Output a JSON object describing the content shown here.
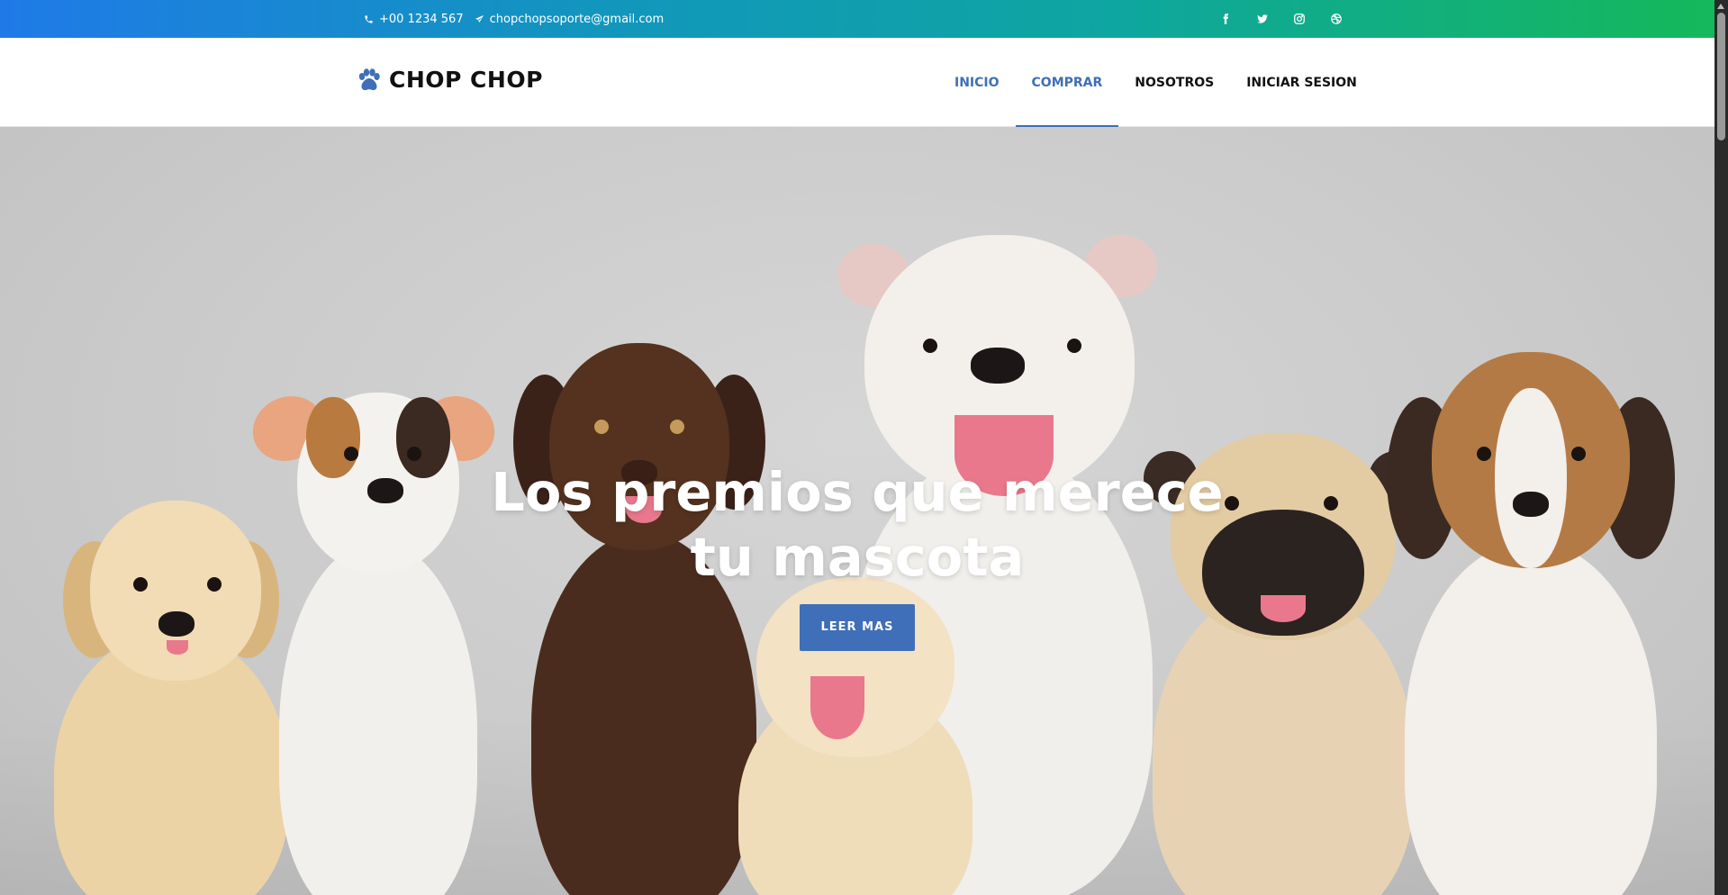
{
  "topbar": {
    "phone": "+00 1234 567",
    "email": "chopchopsoporte@gmail.com",
    "social": [
      "facebook-icon",
      "twitter-icon",
      "instagram-icon",
      "dribbble-icon"
    ]
  },
  "brand": {
    "name": "CHOP CHOP",
    "icon": "paw-icon"
  },
  "nav": {
    "items": [
      {
        "label": "INICIO",
        "state": "active"
      },
      {
        "label": "COMPRAR",
        "state": "hover"
      },
      {
        "label": "NOSOTROS",
        "state": "default"
      },
      {
        "label": "INICIAR SESION",
        "state": "default"
      }
    ]
  },
  "hero": {
    "title": "Los premios que merece tu mascota",
    "cta": "LEER MAS"
  },
  "colors": {
    "accent": "#3f6fb8",
    "topbar_gradient_start": "#1f7ae8",
    "topbar_gradient_end": "#15b85a"
  }
}
